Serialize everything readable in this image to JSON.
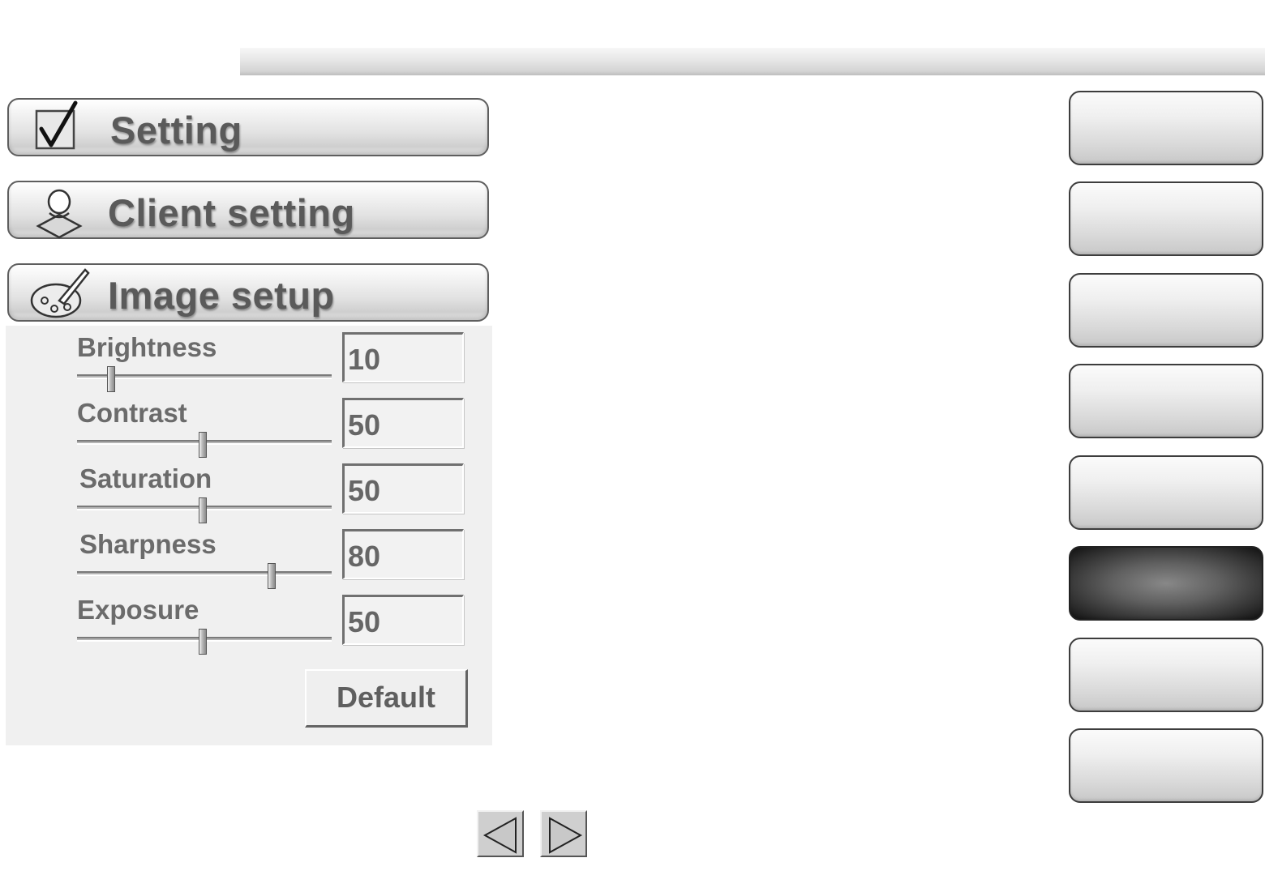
{
  "menu": {
    "setting": {
      "label": "Setting",
      "icon": "checkbox-check-icon"
    },
    "client_setting": {
      "label": "Client setting",
      "icon": "user-person-icon"
    },
    "image_setup": {
      "label": "Image setup",
      "icon": "palette-brush-icon"
    }
  },
  "image_setup": {
    "sliders": [
      {
        "label": "Brightness",
        "value": "10",
        "level": 10
      },
      {
        "label": "Contrast",
        "value": "50",
        "level": 50
      },
      {
        "label": "Saturation",
        "value": "50",
        "level": 50
      },
      {
        "label": "Sharpness",
        "value": "80",
        "level": 80
      },
      {
        "label": "Exposure",
        "value": "50",
        "level": 50
      }
    ],
    "default_label": "Default"
  },
  "side_buttons": {
    "count": 8,
    "active_index": 5
  },
  "navigation": {
    "prev_icon": "triangle-left-icon",
    "next_icon": "triangle-right-icon"
  },
  "colors": {
    "button_text": "#5a5a5a",
    "active_side_button": "#2d2d2d"
  }
}
